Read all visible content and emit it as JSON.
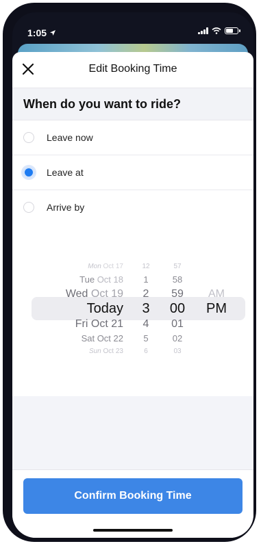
{
  "status_bar": {
    "time": "1:05",
    "location_icon": "location-arrow-icon",
    "signal_icon": "signal-icon",
    "wifi_icon": "wifi-icon",
    "battery_icon": "battery-icon"
  },
  "header": {
    "close_icon": "close-icon",
    "title": "Edit Booking Time"
  },
  "question": "When do you want to ride?",
  "options": [
    {
      "label": "Leave now",
      "selected": false
    },
    {
      "label": "Leave at",
      "selected": true
    },
    {
      "label": "Arrive by",
      "selected": false
    }
  ],
  "picker": {
    "rows": [
      {
        "dow": "Mon",
        "date": " Oct 17",
        "hour": "12",
        "minute": "57",
        "ampm": ""
      },
      {
        "dow": "Tue",
        "date": " Oct 18",
        "hour": "1",
        "minute": "58",
        "ampm": ""
      },
      {
        "dow": "Wed",
        "date": " Oct 19",
        "hour": "2",
        "minute": "59",
        "ampm": "AM"
      },
      {
        "dow": "Today",
        "date": "",
        "hour": "3",
        "minute": "00",
        "ampm": "PM"
      },
      {
        "dow": "Fri",
        "date": " Oct 21",
        "hour": "4",
        "minute": "01",
        "ampm": ""
      },
      {
        "dow": "Sat",
        "date": " Oct 22",
        "hour": "5",
        "minute": "02",
        "ampm": ""
      },
      {
        "dow": "Sun",
        "date": " Oct 23",
        "hour": "6",
        "minute": "03",
        "ampm": ""
      }
    ],
    "selected_index": 3
  },
  "footer": {
    "confirm_label": "Confirm Booking Time"
  },
  "colors": {
    "accent": "#1e7cf2",
    "button": "#3d86e6",
    "selected_row": "#ececf0"
  }
}
